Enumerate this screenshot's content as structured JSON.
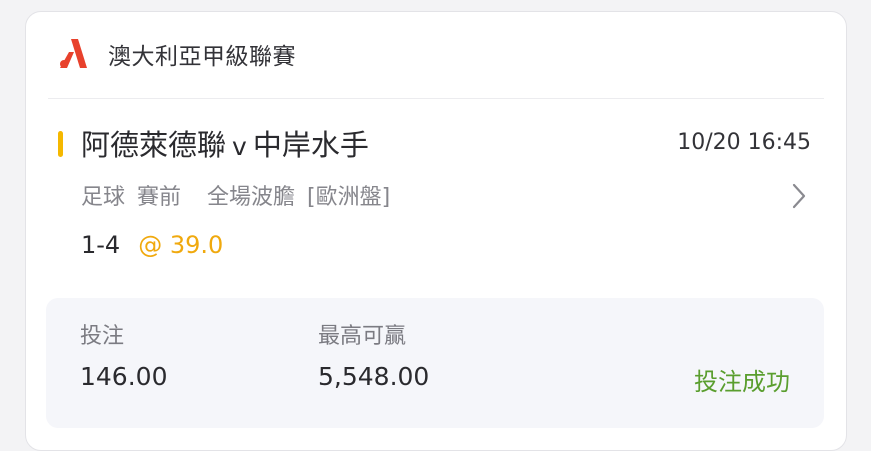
{
  "league": {
    "logo_icon": "league-logo-icon",
    "logo_color": "#e8412c",
    "name": "澳大利亞甲級聯賽"
  },
  "match": {
    "home": "阿德萊德聯",
    "separator": "v",
    "away": "中岸水手",
    "time": "10/20 16:45",
    "accent_color": "#f5b800"
  },
  "bet": {
    "sport": "足球",
    "phase": "賽前",
    "market": "全場波膽",
    "odds_format": "[歐洲盤]",
    "selection": "1-4",
    "odds": "@ 39.0",
    "odds_color": "#f0a90e"
  },
  "summary": {
    "stake_label": "投注",
    "stake_value": "146.00",
    "max_win_label": "最高可贏",
    "max_win_value": "5,548.00",
    "status": "投注成功",
    "status_color": "#5a9e2e"
  }
}
